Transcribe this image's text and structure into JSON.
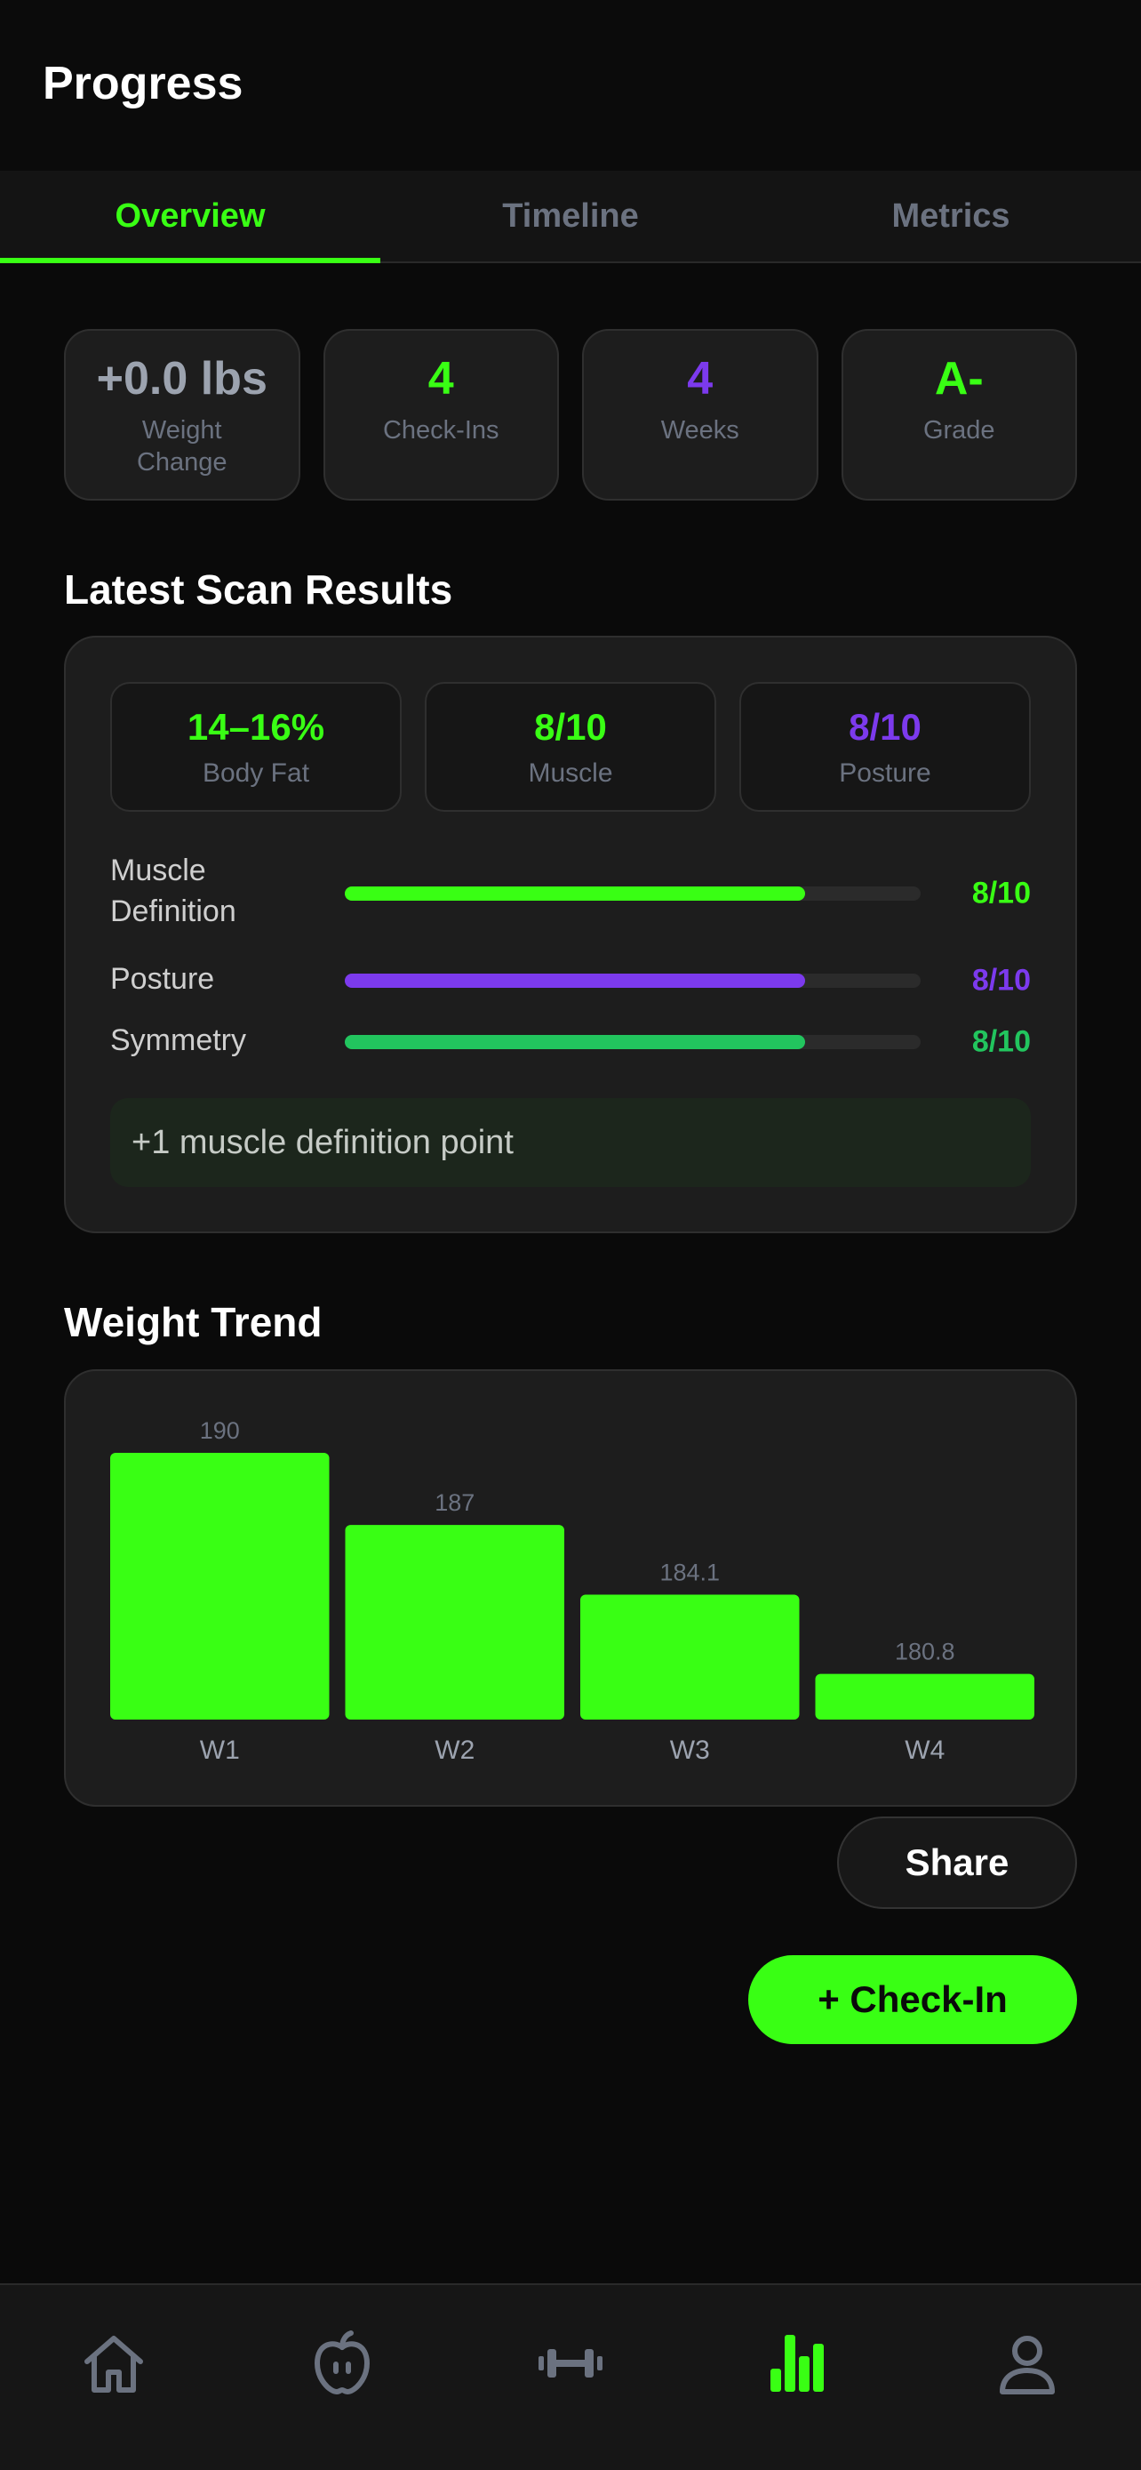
{
  "header": {
    "title": "Progress"
  },
  "tabs": [
    {
      "label": "Overview",
      "active": true
    },
    {
      "label": "Timeline",
      "active": false
    },
    {
      "label": "Metrics",
      "active": false
    }
  ],
  "stats": [
    {
      "value": "+0.0 lbs",
      "label": "Weight Change",
      "color": "#9ca3af"
    },
    {
      "value": "4",
      "label": "Check-Ins",
      "color": "#39ff14"
    },
    {
      "value": "4",
      "label": "Weeks",
      "color": "#7c3aed"
    },
    {
      "value": "A-",
      "label": "Grade",
      "color": "#39ff14"
    }
  ],
  "scan": {
    "title": "Latest Scan Results",
    "boxes": [
      {
        "value": "14–16%",
        "label": "Body Fat",
        "color": "#39ff14"
      },
      {
        "value": "8/10",
        "label": "Muscle",
        "color": "#39ff14"
      },
      {
        "value": "8/10",
        "label": "Posture",
        "color": "#7c3aed"
      }
    ],
    "metrics": [
      {
        "label": "Muscle Definition",
        "score": "8/10",
        "fraction": 0.8,
        "color": "#39ff14"
      },
      {
        "label": "Posture",
        "score": "8/10",
        "fraction": 0.8,
        "color": "#7c3aed"
      },
      {
        "label": "Symmetry",
        "score": "8/10",
        "fraction": 0.8,
        "color": "#22c55e"
      }
    ],
    "note": "+1 muscle definition point"
  },
  "weight_trend": {
    "title": "Weight Trend"
  },
  "chart_data": {
    "type": "bar",
    "categories": [
      "W1",
      "W2",
      "W3",
      "W4"
    ],
    "values": [
      190,
      187,
      184.1,
      180.8
    ],
    "value_labels": [
      "190",
      "187",
      "184.1",
      "180.8"
    ],
    "bar_color": "#39ff14"
  },
  "buttons": {
    "share": "Share",
    "checkin": "+ Check-In"
  },
  "nav": [
    {
      "icon": "home-icon",
      "active": false
    },
    {
      "icon": "apple-icon",
      "active": false
    },
    {
      "icon": "dumbbell-icon",
      "active": false
    },
    {
      "icon": "bar-chart-icon",
      "active": true
    },
    {
      "icon": "profile-icon",
      "active": false
    }
  ],
  "colors": {
    "accent": "#39ff14",
    "purple": "#7c3aed",
    "muted": "#6b7280"
  }
}
